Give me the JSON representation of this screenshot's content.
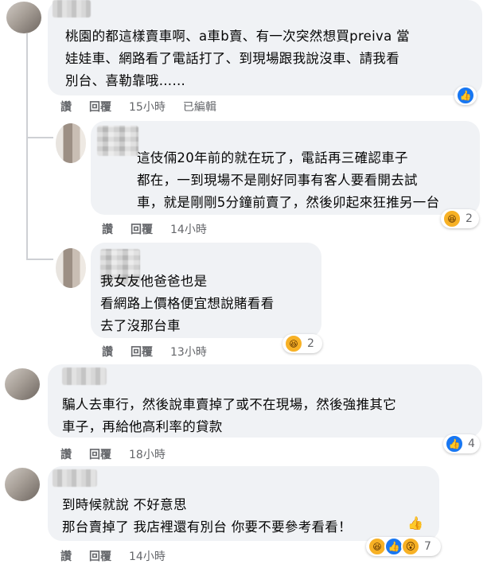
{
  "comments": [
    {
      "text": "桃園的都這樣賣車啊、a車b賣、有一次突然想買preiva 當\n娃娃車、網路看了電話打了、到現場跟我說沒車、請我看\n別台、喜勒靠哦……",
      "actions": [
        "讚",
        "回覆",
        "15小時",
        "已編輯"
      ],
      "reaction_count": ""
    },
    {
      "text": "這伎倆20年前的就在玩了，電話再三確認車子\n都在，一到現場不是剛好同事有客人要看開去試\n車，就是剛剛5分鐘前賣了，然後卯起來狂推另一台",
      "actions": [
        "讚",
        "回覆",
        "14小時"
      ],
      "reaction_count": "2"
    },
    {
      "text": "我女友他爸爸也是\n看網路上價格便宜想說賭看看\n去了沒那台車",
      "actions": [
        "讚",
        "回覆",
        "13小時"
      ],
      "reaction_count": "2"
    },
    {
      "text": "騙人去車行，然後說車賣掉了或不在現場，然後強推其它\n車子，再給他高利率的貸款",
      "actions": [
        "讚",
        "回覆",
        "18小時"
      ],
      "reaction_count": "4"
    },
    {
      "text": "到時候就說 不好意思\n那台賣掉了 我店裡還有別台 你要不要參考看看！",
      "actions": [
        "讚",
        "回覆",
        "14小時"
      ],
      "reaction_count": "7"
    }
  ],
  "icons": {
    "like": "like-icon",
    "haha": "haha-icon",
    "wow": "wow-icon",
    "hand": "hand-emoji-icon"
  },
  "colors": {
    "bubble": "#f0f2f5",
    "muted": "#65676b",
    "like_blue": "#1877f2",
    "emoji_yellow": "#f7b125"
  }
}
